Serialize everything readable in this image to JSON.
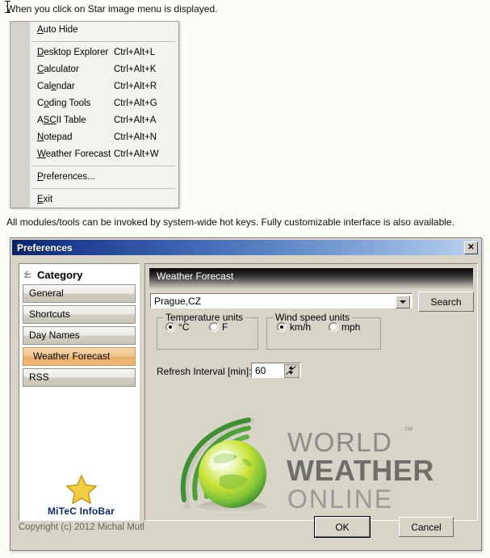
{
  "captions": {
    "top": "When you click on Star image menu is displayed.",
    "bottom": "All modules/tools can be invoked by system-wide hot keys. Fully customizable interface is also available."
  },
  "menu": {
    "items": [
      {
        "label": "Auto Hide",
        "accel_index": 0,
        "shortcut": ""
      },
      {
        "separator": true
      },
      {
        "label": "Desktop Explorer",
        "accel_index": 0,
        "shortcut": "Ctrl+Alt+L"
      },
      {
        "label": "Calculator",
        "accel_index": 0,
        "shortcut": "Ctrl+Alt+K"
      },
      {
        "label": "Calendar",
        "accel_index": 3,
        "shortcut": "Ctrl+Alt+R"
      },
      {
        "label": "Coding Tools",
        "accel_index": 1,
        "shortcut": "Ctrl+Alt+G"
      },
      {
        "label": "ASCII Table",
        "accel_index": 1,
        "accel_len": 2,
        "shortcut": "Ctrl+Alt+A"
      },
      {
        "label": "Notepad",
        "accel_index": 0,
        "shortcut": "Ctrl+Alt+N"
      },
      {
        "label": "Weather Forecast",
        "accel_index": 0,
        "shortcut": "Ctrl+Alt+W"
      },
      {
        "separator": true
      },
      {
        "label": "Preferences...",
        "accel_index": 0,
        "shortcut": ""
      },
      {
        "separator": true
      },
      {
        "label": "Exit",
        "accel_index": 0,
        "shortcut": ""
      }
    ]
  },
  "dialog": {
    "title": "Preferences",
    "close_label": "✕",
    "sidebar": {
      "header": "Category",
      "items": [
        {
          "label": "General",
          "selected": false
        },
        {
          "label": "Shortcuts",
          "selected": false
        },
        {
          "label": "Day Names",
          "selected": false
        },
        {
          "label": "Weather Forecast",
          "selected": true
        },
        {
          "label": "RSS",
          "selected": false
        }
      ],
      "brand_name": "MiTeC InfoBar"
    },
    "panel": {
      "header": "Weather Forecast",
      "location_value": "Prague,CZ",
      "search_label": "Search",
      "temperature_group": {
        "title": "Temperature units",
        "options": [
          {
            "label": "°C",
            "checked": true
          },
          {
            "label": "F",
            "checked": false
          }
        ]
      },
      "wind_group": {
        "title": "Wind speed units",
        "options": [
          {
            "label": "km/h",
            "checked": true
          },
          {
            "label": "mph",
            "checked": false
          }
        ]
      },
      "refresh_label": "Refresh Interval [min]:",
      "refresh_value": "60",
      "logo": {
        "line1": "WORLD",
        "line2": "WEATHER",
        "line3": "ONLINE",
        "trademark": "™"
      }
    },
    "footer": {
      "copyright": "Copyright (c) 2012 Michal Mutl",
      "ok_label": "OK",
      "cancel_label": "Cancel"
    }
  },
  "colors": {
    "title_dark": "#0a246a",
    "title_light": "#c2d6ef",
    "selected_item": "#edb878",
    "brand_blue": "#102a6e",
    "star_gold": "#f0c838",
    "logo_green": "#4ba035",
    "dialog_face": "#d8d4c8"
  }
}
